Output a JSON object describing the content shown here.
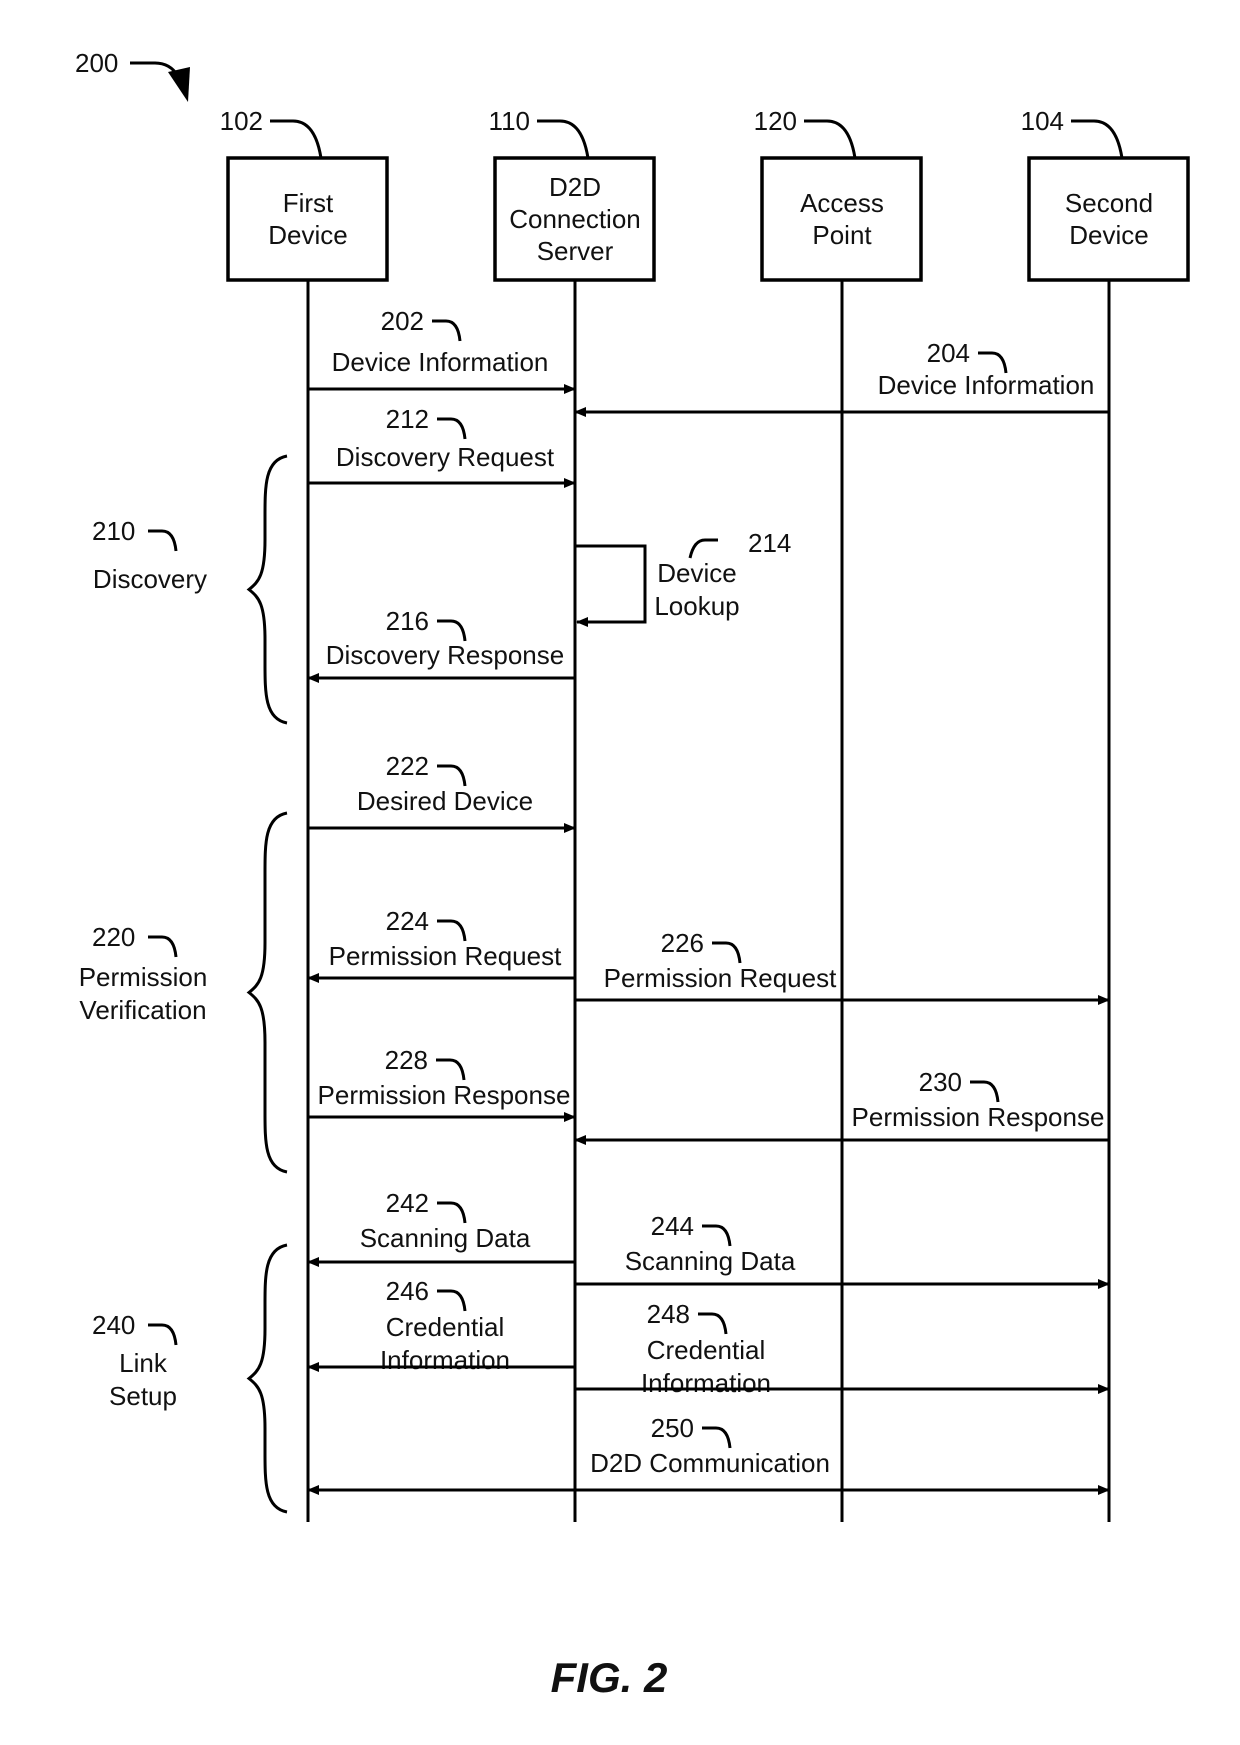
{
  "figure": {
    "ref": "200",
    "caption": "FIG. 2"
  },
  "entities": [
    {
      "ref": "102",
      "lines": [
        "First",
        "Device"
      ]
    },
    {
      "ref": "110",
      "lines": [
        "D2D",
        "Connection",
        "Server"
      ]
    },
    {
      "ref": "120",
      "lines": [
        "Access",
        "Point"
      ]
    },
    {
      "ref": "104",
      "lines": [
        "Second",
        "Device"
      ]
    }
  ],
  "messages": [
    {
      "ref": "202",
      "lines": [
        "Device Information"
      ],
      "from": 0,
      "to": 1
    },
    {
      "ref": "204",
      "lines": [
        "Device Information"
      ],
      "from": 3,
      "to": 1
    },
    {
      "ref": "212",
      "lines": [
        "Discovery Request"
      ],
      "from": 0,
      "to": 1
    },
    {
      "ref": "214",
      "lines": [
        "Device",
        "Lookup"
      ],
      "from": 1,
      "to": 1
    },
    {
      "ref": "216",
      "lines": [
        "Discovery Response"
      ],
      "from": 1,
      "to": 0
    },
    {
      "ref": "222",
      "lines": [
        "Desired Device"
      ],
      "from": 0,
      "to": 1
    },
    {
      "ref": "224",
      "lines": [
        "Permission Request"
      ],
      "from": 1,
      "to": 0
    },
    {
      "ref": "226",
      "lines": [
        "Permission Request"
      ],
      "from": 1,
      "to": 3
    },
    {
      "ref": "228",
      "lines": [
        "Permission Response"
      ],
      "from": 0,
      "to": 1
    },
    {
      "ref": "230",
      "lines": [
        "Permission Response"
      ],
      "from": 3,
      "to": 1
    },
    {
      "ref": "242",
      "lines": [
        "Scanning Data"
      ],
      "from": 1,
      "to": 0
    },
    {
      "ref": "244",
      "lines": [
        "Scanning Data"
      ],
      "from": 1,
      "to": 3
    },
    {
      "ref": "246",
      "lines": [
        "Credential",
        "Information"
      ],
      "from": 1,
      "to": 0
    },
    {
      "ref": "248",
      "lines": [
        "Credential",
        "Information"
      ],
      "from": 1,
      "to": 3
    },
    {
      "ref": "250",
      "lines": [
        "D2D Communication"
      ],
      "from": 0,
      "to": 3,
      "bidirectional": true
    }
  ],
  "phases": [
    {
      "ref": "210",
      "lines": [
        "Discovery"
      ]
    },
    {
      "ref": "220",
      "lines": [
        "Permission",
        "Verification"
      ]
    },
    {
      "ref": "240",
      "lines": [
        "Link",
        "Setup"
      ]
    }
  ]
}
